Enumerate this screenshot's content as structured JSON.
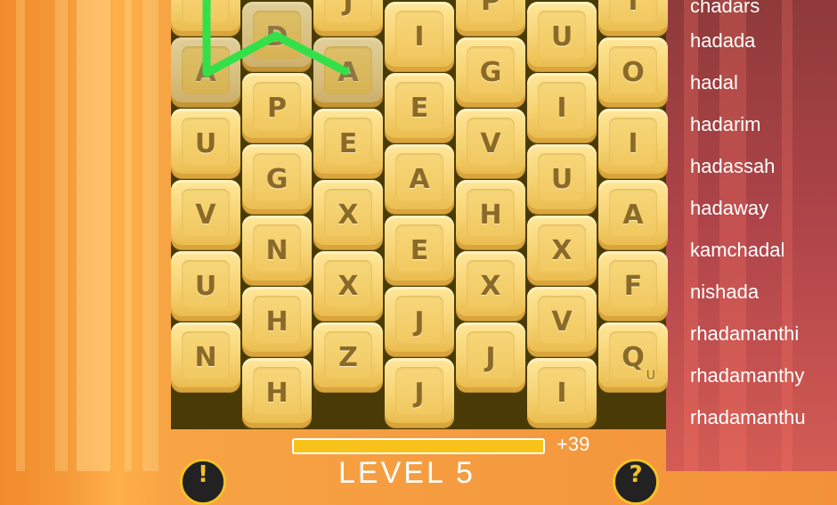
{
  "board": {
    "columns": [
      [
        "",
        "A",
        "U",
        "V",
        "U",
        "N"
      ],
      [
        "D",
        "P",
        "G",
        "N",
        "H",
        "H"
      ],
      [
        "J",
        "A",
        "E",
        "X",
        "X",
        "Z"
      ],
      [
        "I",
        "E",
        "A",
        "E",
        "J",
        "J"
      ],
      [
        "P",
        "G",
        "V",
        "H",
        "X",
        "J"
      ],
      [
        "U",
        "I",
        "U",
        "X",
        "V",
        "I"
      ],
      [
        "I",
        "O",
        "I",
        "A",
        "F",
        "Q"
      ]
    ],
    "q_subscript": "U",
    "selected_path_letters": [
      "",
      "A",
      "D",
      "A"
    ]
  },
  "found_words": [
    "chadars",
    "hadada",
    "hadal",
    "hadarim",
    "hadassah",
    "hadaway",
    "kamchadal",
    "nishada",
    "rhadamanthi",
    "rhadamanthy",
    "rhadamanthu"
  ],
  "progress": {
    "fraction": 1.0
  },
  "score_delta": "+39",
  "level_label": "LEVEL 5",
  "colors": {
    "path": "#34e04a",
    "tile": "#f6d271",
    "letter": "#8a6a28",
    "board_bg": "#4a3b06"
  }
}
